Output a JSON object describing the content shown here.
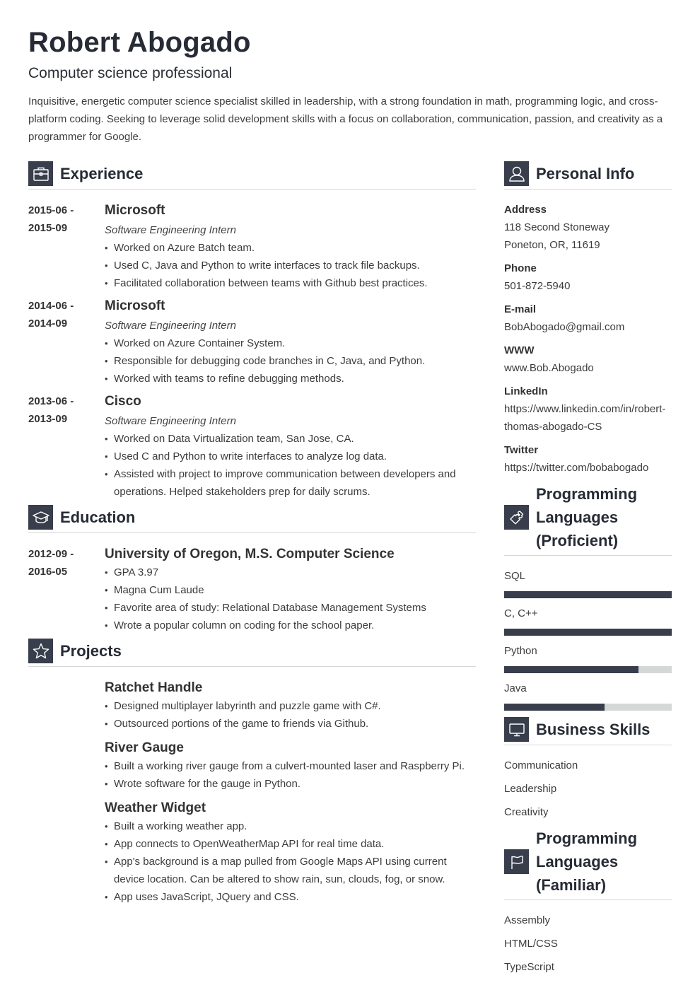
{
  "header": {
    "name": "Robert Abogado",
    "title": "Computer science professional",
    "summary": "Inquisitive, energetic computer science specialist skilled in leadership, with a strong foundation in math, programming logic, and cross-platform coding. Seeking to leverage solid development skills with a focus on collaboration, communication, passion, and creativity as a programmer for Google."
  },
  "experience": {
    "heading": "Experience",
    "icon": "briefcase-icon",
    "items": [
      {
        "date_start": "2015-06 -",
        "date_end": "2015-09",
        "org": "Microsoft",
        "role": "Software Engineering Intern",
        "bullets": [
          "Worked on Azure Batch team.",
          "Used C, Java and Python to write interfaces to track file backups.",
          "Facilitated collaboration between teams with Github best practices."
        ]
      },
      {
        "date_start": "2014-06 -",
        "date_end": "2014-09",
        "org": "Microsoft",
        "role": "Software Engineering Intern",
        "bullets": [
          "Worked on Azure Container System.",
          "Responsible for debugging code branches in C, Java, and Python.",
          "Worked with teams to refine debugging methods."
        ]
      },
      {
        "date_start": "2013-06 -",
        "date_end": "2013-09",
        "org": "Cisco",
        "role": "Software Engineering Intern",
        "bullets": [
          "Worked on Data Virtualization team, San Jose, CA.",
          "Used C and Python to write interfaces to analyze log data.",
          "Assisted with project to improve communication between developers and operations. Helped stakeholders prep for daily scrums."
        ]
      }
    ]
  },
  "education": {
    "heading": "Education",
    "icon": "graduation-cap-icon",
    "items": [
      {
        "date_start": "2012-09 -",
        "date_end": "2016-05",
        "org": "University of Oregon, M.S. Computer Science",
        "bullets": [
          "GPA 3.97",
          "Magna Cum Laude",
          "Favorite area of study: Relational Database Management Systems",
          "Wrote a popular column on coding for the school paper."
        ]
      }
    ]
  },
  "projects": {
    "heading": "Projects",
    "icon": "star-icon",
    "items": [
      {
        "name": "Ratchet Handle",
        "bullets": [
          "Designed multiplayer labyrinth and puzzle game with C#.",
          "Outsourced portions of the game to friends via Github."
        ]
      },
      {
        "name": "River Gauge",
        "bullets": [
          "Built a working river gauge from a culvert-mounted laser and Raspberry Pi.",
          "Wrote software for the gauge in Python."
        ]
      },
      {
        "name": "Weather Widget",
        "bullets": [
          "Built a working weather app.",
          "App connects to OpenWeatherMap API for real time data.",
          "App's background is a map pulled from Google Maps API using current device location. Can be altered to show rain, sun, clouds, fog, or snow.",
          "App uses JavaScript, JQuery and CSS."
        ]
      }
    ]
  },
  "personal_info": {
    "heading": "Personal Info",
    "icon": "user-icon",
    "fields": [
      {
        "label": "Address",
        "lines": [
          "118 Second Stoneway",
          "Poneton, OR, 11619"
        ]
      },
      {
        "label": "Phone",
        "lines": [
          "501-872-5940"
        ]
      },
      {
        "label": "E-mail",
        "lines": [
          "BobAbogado@gmail.com"
        ]
      },
      {
        "label": "WWW",
        "lines": [
          "www.Bob.Abogado"
        ]
      },
      {
        "label": "LinkedIn",
        "lines": [
          "https://www.linkedin.com/in/robert-thomas-abogado-CS"
        ]
      },
      {
        "label": "Twitter",
        "lines": [
          "https://twitter.com/bobabogado"
        ]
      }
    ]
  },
  "languages_proficient": {
    "heading": "Programming Languages (Proficient)",
    "icon": "puzzle-icon",
    "skills": [
      {
        "name": "SQL",
        "level_percent": 100
      },
      {
        "name": "C, C++",
        "level_percent": 100
      },
      {
        "name": "Python",
        "level_percent": 80
      },
      {
        "name": "Java",
        "level_percent": 60
      }
    ]
  },
  "business_skills": {
    "heading": "Business Skills",
    "icon": "monitor-icon",
    "items": [
      "Communication",
      "Leadership",
      "Creativity"
    ]
  },
  "languages_familiar": {
    "heading": "Programming Languages (Familiar)",
    "icon": "flag-icon",
    "items": [
      "Assembly",
      "HTML/CSS",
      "TypeScript"
    ]
  },
  "colors": {
    "accent": "#383e4b",
    "text": "#3c3c3c",
    "bar_track": "#d6d7d7",
    "divider": "#d6d6d6"
  }
}
